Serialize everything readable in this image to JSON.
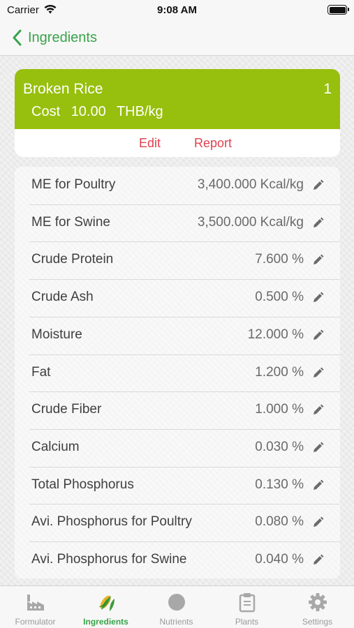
{
  "status_bar": {
    "carrier": "Carrier",
    "time": "9:08 AM"
  },
  "nav": {
    "back_label": "Ingredients"
  },
  "ingredient": {
    "name": "Broken Rice",
    "index": "1",
    "cost_label": "Cost",
    "cost_value": "10.00",
    "cost_unit": "THB/kg",
    "header_color": "#97bf0d",
    "actions": {
      "edit": "Edit",
      "report": "Report"
    }
  },
  "nutrients": [
    {
      "name": "ME for Poultry",
      "value": "3,400.000 Kcal/kg"
    },
    {
      "name": "ME for Swine",
      "value": "3,500.000 Kcal/kg"
    },
    {
      "name": "Crude Protein",
      "value": "7.600 %"
    },
    {
      "name": "Crude Ash",
      "value": "0.500 %"
    },
    {
      "name": "Moisture",
      "value": "12.000 %"
    },
    {
      "name": "Fat",
      "value": "1.200 %"
    },
    {
      "name": "Crude Fiber",
      "value": "1.000 %"
    },
    {
      "name": "Calcium",
      "value": "0.030 %"
    },
    {
      "name": "Total Phosphorus",
      "value": "0.130 %"
    },
    {
      "name": "Avi. Phosphorus for Poultry",
      "value": "0.080 %"
    },
    {
      "name": "Avi. Phosphorus for Swine",
      "value": "0.040 %"
    }
  ],
  "tabs": [
    {
      "label": "Formulator",
      "icon": "factory-icon",
      "active": false
    },
    {
      "label": "Ingredients",
      "icon": "corn-icon",
      "active": true
    },
    {
      "label": "Nutrients",
      "icon": "circle-icon",
      "active": false
    },
    {
      "label": "Plants",
      "icon": "clipboard-icon",
      "active": false
    },
    {
      "label": "Settings",
      "icon": "gear-icon",
      "active": false
    }
  ],
  "colors": {
    "accent": "#39a34a",
    "action_red": "#e0414f",
    "inactive": "#9a9a9a"
  }
}
